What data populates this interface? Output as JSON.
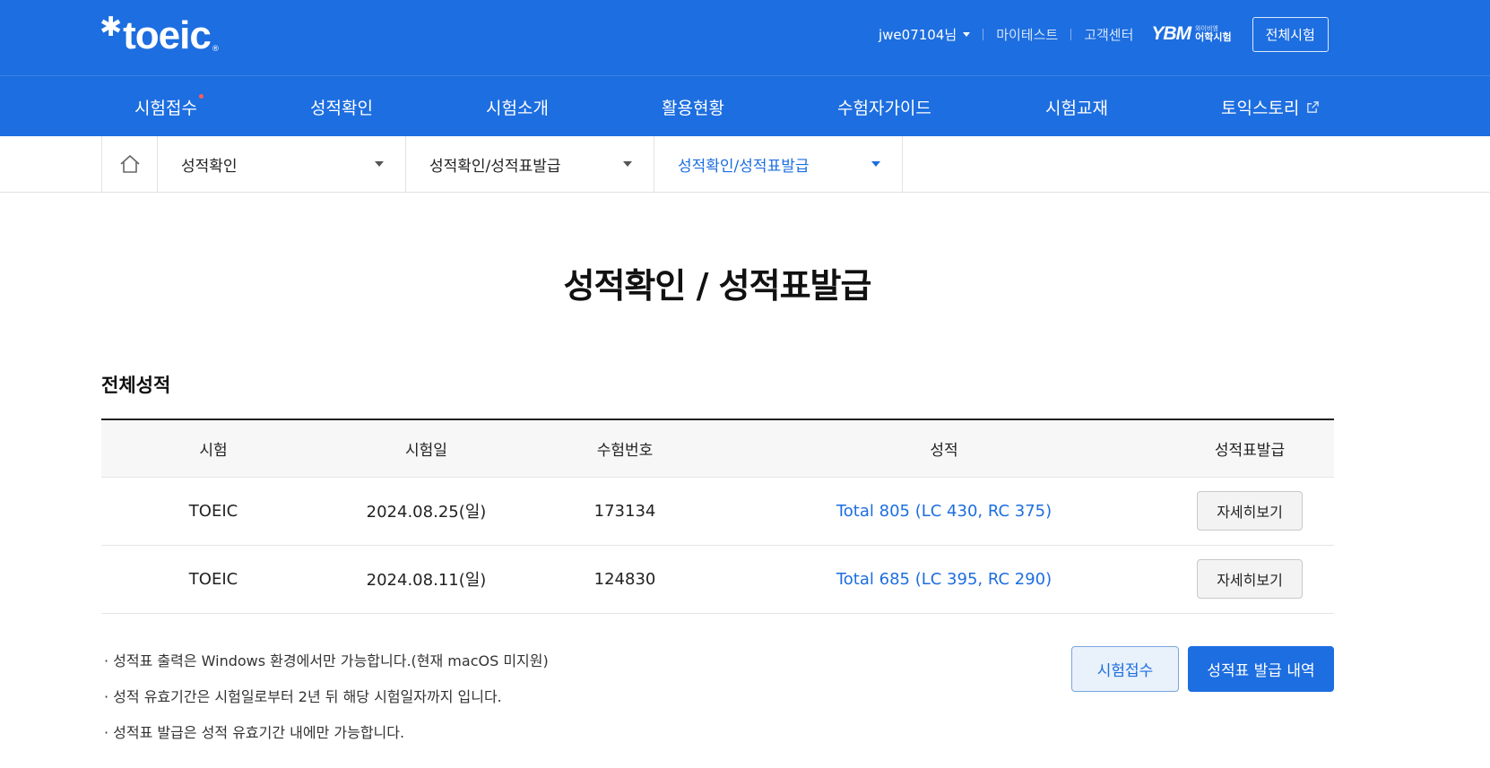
{
  "header": {
    "logo_text": "toeic",
    "logo_mark": "✱",
    "logo_reg": "®",
    "user_name": "jwe07104님",
    "util_links": [
      "마이테스트",
      "고객센터"
    ],
    "ybm_mark": "YBM",
    "ybm_small": "와이비엠",
    "ybm_text": "어학시험",
    "all_tests_label": "전체시험"
  },
  "gnb": {
    "items": [
      {
        "label": "시험접수"
      },
      {
        "label": "성적확인"
      },
      {
        "label": "시험소개"
      },
      {
        "label": "활용현황"
      },
      {
        "label": "수험자가이드"
      },
      {
        "label": "시험교재"
      },
      {
        "label": "토익스토리"
      }
    ]
  },
  "breadcrumb": {
    "depth1": "성적확인",
    "depth2": "성적확인/성적표발급",
    "depth3": "성적확인/성적표발급"
  },
  "main": {
    "title": "성적확인 / 성적표발급",
    "section_title": "전체성적"
  },
  "table": {
    "headers": [
      "시험",
      "시험일",
      "수험번호",
      "성적",
      "성적표발급"
    ],
    "rows": [
      {
        "exam": "TOEIC",
        "date": "2024.08.25(일)",
        "number": "173134",
        "score": "Total 805 (LC 430, RC 375)",
        "action": "자세히보기"
      },
      {
        "exam": "TOEIC",
        "date": "2024.08.11(일)",
        "number": "124830",
        "score": "Total 685 (LC 395, RC 290)",
        "action": "자세히보기"
      }
    ]
  },
  "notes": [
    "· 성적표 출력은 Windows 환경에서만 가능합니다.(현재 macOS 미지원)",
    "· 성적 유효기간은 시험일로부터 2년 뒤 해당 시험일자까지 입니다.",
    "· 성적표 발급은 성적 유효기간 내에만 가능합니다."
  ],
  "buttons": {
    "register": "시험접수",
    "history": "성적표 발급 내역"
  },
  "colors": {
    "brand_blue": "#1d6ee0",
    "new_dot": "#ff5b5b"
  },
  "icons": {
    "home": "home-icon",
    "external": "external-link-icon",
    "caret": "caret-down-icon"
  }
}
